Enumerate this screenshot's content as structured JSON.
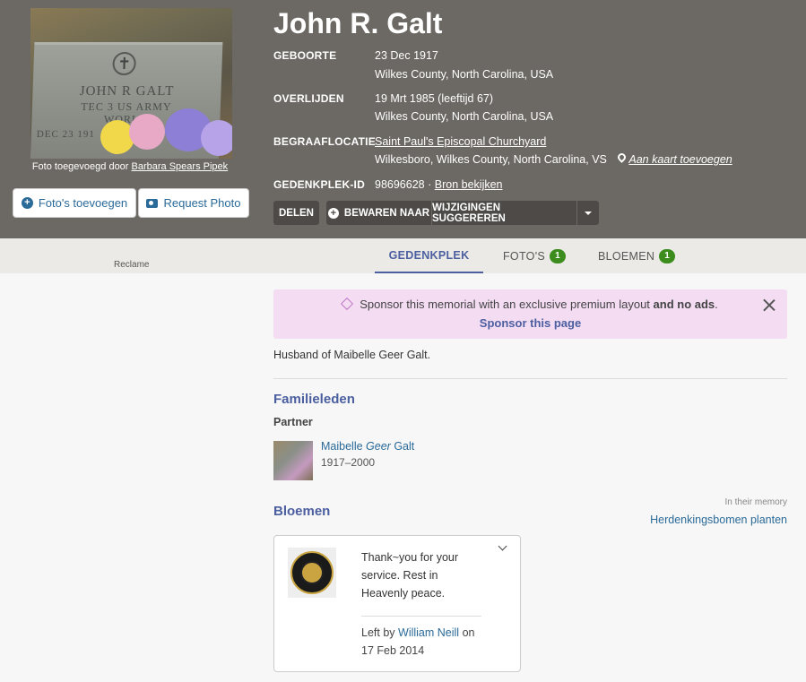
{
  "photo": {
    "stone_name": "JOHN R GALT",
    "stone_line2": "TEC 3 US ARMY",
    "stone_line3": "WORLD",
    "stone_line4": "DEC 23 191",
    "credit_prefix": "Foto toegevoegd door",
    "credit_name": "Barbara Spears Pipek"
  },
  "buttons": {
    "add_photos": "Foto's toevoegen",
    "request_photo": "Request Photo",
    "share": "DELEN",
    "save_to": "BEWAREN NAAR",
    "suggest_edits": "WIJZIGINGEN SUGGEREREN"
  },
  "memorial": {
    "name": "John R. Galt",
    "birth_label": "GEBOORTE",
    "birth_date": "23 Dec 1917",
    "birth_place": "Wilkes County, North Carolina, USA",
    "death_label": "OVERLIJDEN",
    "death_date": "19 Mrt 1985 (leeftijd 67)",
    "death_place": "Wilkes County, North Carolina, USA",
    "burial_label": "BEGRAAFLOCATIE",
    "burial_name": "Saint Paul's Episcopal Churchyard",
    "burial_place": "Wilkesboro, Wilkes County, North Carolina, VS",
    "map_link": "Aan kaart toevoegen",
    "id_label": "GEDENKPLEK-ID",
    "id_value": "98696628",
    "id_sep": "·",
    "source_link": "Bron bekijken"
  },
  "tabs": {
    "ad_label": "Reclame",
    "memorial": "GEDENKPLEK",
    "photos": "FOTO'S",
    "photos_count": "1",
    "flowers": "BLOEMEN",
    "flowers_count": "1"
  },
  "sponsor": {
    "text_pre": "Sponsor this memorial with an exclusive premium layout ",
    "text_bold": "and no ads",
    "text_post": ".",
    "link": "Sponsor this page"
  },
  "bio": "Husband of Maibelle Geer Galt.",
  "family": {
    "title": "Familieleden",
    "partner_label": "Partner",
    "partner_first": "Maibelle",
    "partner_middle": "Geer",
    "partner_last": "Galt",
    "partner_years": "1917–2000"
  },
  "flowers": {
    "title": "Bloemen",
    "in_memory": "In their memory",
    "plant_trees": "Herdenkingsbomen planten",
    "message": "Thank~you for your service. Rest in Heavenly peace.",
    "left_by_prefix": "Left by",
    "left_by_name": "William Neill",
    "left_by_on": "on",
    "date": "17 Feb 2014"
  },
  "colors": {
    "header_bg": "#6c6863",
    "accent_blue": "#4b5fa0",
    "link_blue": "#2a6a99",
    "badge_green": "#3c8c1e",
    "sponsor_bg": "#f4dcf3"
  }
}
